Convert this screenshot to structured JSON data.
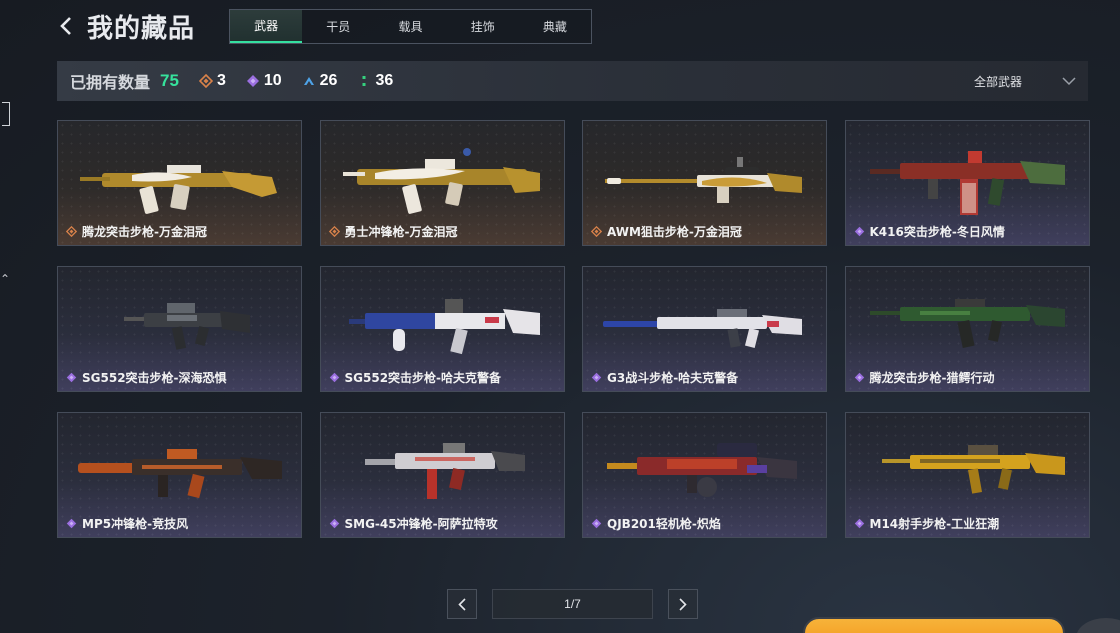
{
  "header": {
    "title": "我的藏品"
  },
  "tabs": [
    {
      "label": "武器",
      "active": true
    },
    {
      "label": "干员",
      "active": false
    },
    {
      "label": "载具",
      "active": false
    },
    {
      "label": "挂饰",
      "active": false
    },
    {
      "label": "典藏",
      "active": false
    }
  ],
  "stats": {
    "owned_label": "已拥有数量",
    "owned_count": "75",
    "rarities": [
      {
        "icon": "orange-diamond-icon",
        "color": "#d9824a",
        "count": "3"
      },
      {
        "icon": "purple-diamond-icon",
        "color": "#9b6fe0",
        "count": "10"
      },
      {
        "icon": "blue-chevron-icon",
        "color": "#4ea3e8",
        "count": "26"
      },
      {
        "icon": "green-dots-icon",
        "color": "#35d17e",
        "count": "36"
      }
    ],
    "filter_label": "全部武器"
  },
  "colors": {
    "accent": "#36e29c",
    "gold_rarity": "#d9824a",
    "purple_rarity": "#9b6fe0"
  },
  "items": [
    {
      "name": "腾龙突击步枪-万金泪冠",
      "rarity": "gold"
    },
    {
      "name": "勇士冲锋枪-万金泪冠",
      "rarity": "gold"
    },
    {
      "name": "AWM狙击步枪-万金泪冠",
      "rarity": "gold"
    },
    {
      "name": "K416突击步枪-冬日风情",
      "rarity": "purple"
    },
    {
      "name": "SG552突击步枪-深海恐惧",
      "rarity": "purple"
    },
    {
      "name": "SG552突击步枪-哈夫克警备",
      "rarity": "purple"
    },
    {
      "name": "G3战斗步枪-哈夫克警备",
      "rarity": "purple"
    },
    {
      "name": "腾龙突击步枪-猎鳄行动",
      "rarity": "purple"
    },
    {
      "name": "MP5冲锋枪-竞技风",
      "rarity": "purple"
    },
    {
      "name": "SMG-45冲锋枪-阿萨拉特攻",
      "rarity": "purple"
    },
    {
      "name": "QJB201轻机枪-炽焰",
      "rarity": "purple"
    },
    {
      "name": "M14射手步枪-工业狂潮",
      "rarity": "purple"
    }
  ],
  "pager": {
    "indicator": "1/7"
  }
}
